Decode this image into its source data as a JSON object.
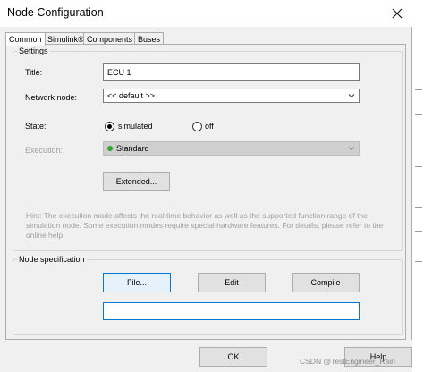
{
  "window": {
    "title": "Node Configuration"
  },
  "tabs": [
    {
      "label": "Common"
    },
    {
      "label": "Simulink®"
    },
    {
      "label": "Components"
    },
    {
      "label": "Buses"
    }
  ],
  "settings": {
    "legend": "Settings",
    "title_label": "Title:",
    "title_value": "ECU 1",
    "network_node_label": "Network node:",
    "network_node_value": "<< default >>",
    "state_label": "State:",
    "state_simulated": "simulated",
    "state_off": "off",
    "execution_label": "Execution:",
    "execution_value": "Standard",
    "extended_button": "Extended...",
    "hint": "Hint: The execution mode affects the real time behavior as well as the supported function range of the simulation node. Some execution modes require special hardware features. For details, please refer to the online help."
  },
  "node_spec": {
    "legend": "Node specification",
    "file_button": "File...",
    "edit_button": "Edit",
    "compile_button": "Compile",
    "path_value": ""
  },
  "footer": {
    "ok_button": "OK",
    "help_button": "Help"
  },
  "watermark": "CSDN @TestEngineer_Rain"
}
